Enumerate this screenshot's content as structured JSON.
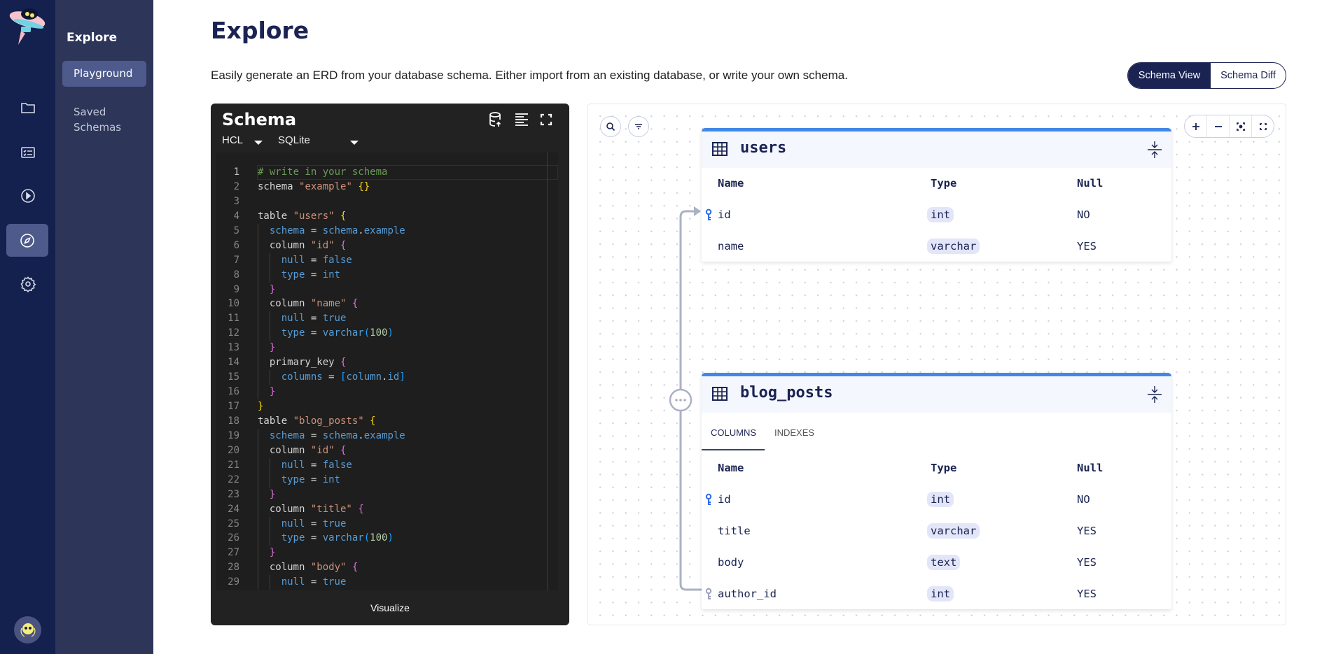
{
  "sidebar": {
    "section_title": "Explore",
    "items": [
      {
        "label": "Playground",
        "active": true
      },
      {
        "label": "Saved Schemas",
        "active": false
      }
    ],
    "rail_icons": [
      "folder-icon",
      "checklist-icon",
      "play-circle-icon",
      "compass-icon",
      "gear-icon"
    ],
    "active_rail": "compass-icon"
  },
  "header": {
    "title": "Explore",
    "description": "Easily generate an ERD from your database schema. Either import from an existing database, or write your own schema.",
    "view_toggle": [
      {
        "label": "Schema View",
        "active": true
      },
      {
        "label": "Schema Diff",
        "active": false
      }
    ]
  },
  "editor": {
    "title": "Schema",
    "language": "HCL",
    "dialect": "SQLite",
    "visualize_label": "Visualize",
    "lines": [
      [
        [
          "# write in your schema",
          "c"
        ]
      ],
      [
        [
          "schema ",
          "p"
        ],
        [
          "\"example\"",
          "s"
        ],
        [
          " ",
          "p"
        ],
        [
          "{}",
          "b1"
        ]
      ],
      [],
      [
        [
          "table ",
          "p"
        ],
        [
          "\"users\"",
          "s"
        ],
        [
          " ",
          "p"
        ],
        [
          "{",
          "b1"
        ]
      ],
      [
        [
          "  ",
          "i"
        ],
        [
          "schema",
          "a"
        ],
        [
          " = ",
          "p"
        ],
        [
          "schema",
          "a"
        ],
        [
          ".",
          "p"
        ],
        [
          "example",
          "a"
        ]
      ],
      [
        [
          "  ",
          "i"
        ],
        [
          "column ",
          "p"
        ],
        [
          "\"id\"",
          "s"
        ],
        [
          " ",
          "p"
        ],
        [
          "{",
          "b2"
        ]
      ],
      [
        [
          "    ",
          "i"
        ],
        [
          "null",
          "a"
        ],
        [
          " = ",
          "p"
        ],
        [
          "false",
          "a"
        ]
      ],
      [
        [
          "    ",
          "i"
        ],
        [
          "type",
          "a"
        ],
        [
          " = ",
          "p"
        ],
        [
          "int",
          "a"
        ]
      ],
      [
        [
          "  ",
          "i"
        ],
        [
          "}",
          "b2"
        ]
      ],
      [
        [
          "  ",
          "i"
        ],
        [
          "column ",
          "p"
        ],
        [
          "\"name\"",
          "s"
        ],
        [
          " ",
          "p"
        ],
        [
          "{",
          "b2"
        ]
      ],
      [
        [
          "    ",
          "i"
        ],
        [
          "null",
          "a"
        ],
        [
          " = ",
          "p"
        ],
        [
          "true",
          "a"
        ]
      ],
      [
        [
          "    ",
          "i"
        ],
        [
          "type",
          "a"
        ],
        [
          " = ",
          "p"
        ],
        [
          "varchar",
          "a"
        ],
        [
          "(",
          "b3"
        ],
        [
          "100",
          "n"
        ],
        [
          ")",
          "b3"
        ]
      ],
      [
        [
          "  ",
          "i"
        ],
        [
          "}",
          "b2"
        ]
      ],
      [
        [
          "  ",
          "i"
        ],
        [
          "primary_key ",
          "p"
        ],
        [
          "{",
          "b2"
        ]
      ],
      [
        [
          "    ",
          "i"
        ],
        [
          "columns",
          "a"
        ],
        [
          " = ",
          "p"
        ],
        [
          "[",
          "b3"
        ],
        [
          "column",
          "a"
        ],
        [
          ".",
          "p"
        ],
        [
          "id",
          "a"
        ],
        [
          "]",
          "b3"
        ]
      ],
      [
        [
          "  ",
          "i"
        ],
        [
          "}",
          "b2"
        ]
      ],
      [
        [
          "}",
          "b1"
        ]
      ],
      [
        [
          "table ",
          "p"
        ],
        [
          "\"blog_posts\"",
          "s"
        ],
        [
          " ",
          "p"
        ],
        [
          "{",
          "b1"
        ]
      ],
      [
        [
          "  ",
          "i"
        ],
        [
          "schema",
          "a"
        ],
        [
          " = ",
          "p"
        ],
        [
          "schema",
          "a"
        ],
        [
          ".",
          "p"
        ],
        [
          "example",
          "a"
        ]
      ],
      [
        [
          "  ",
          "i"
        ],
        [
          "column ",
          "p"
        ],
        [
          "\"id\"",
          "s"
        ],
        [
          " ",
          "p"
        ],
        [
          "{",
          "b2"
        ]
      ],
      [
        [
          "    ",
          "i"
        ],
        [
          "null",
          "a"
        ],
        [
          " = ",
          "p"
        ],
        [
          "false",
          "a"
        ]
      ],
      [
        [
          "    ",
          "i"
        ],
        [
          "type",
          "a"
        ],
        [
          " = ",
          "p"
        ],
        [
          "int",
          "a"
        ]
      ],
      [
        [
          "  ",
          "i"
        ],
        [
          "}",
          "b2"
        ]
      ],
      [
        [
          "  ",
          "i"
        ],
        [
          "column ",
          "p"
        ],
        [
          "\"title\"",
          "s"
        ],
        [
          " ",
          "p"
        ],
        [
          "{",
          "b2"
        ]
      ],
      [
        [
          "    ",
          "i"
        ],
        [
          "null",
          "a"
        ],
        [
          " = ",
          "p"
        ],
        [
          "true",
          "a"
        ]
      ],
      [
        [
          "    ",
          "i"
        ],
        [
          "type",
          "a"
        ],
        [
          " = ",
          "p"
        ],
        [
          "varchar",
          "a"
        ],
        [
          "(",
          "b3"
        ],
        [
          "100",
          "n"
        ],
        [
          ")",
          "b3"
        ]
      ],
      [
        [
          "  ",
          "i"
        ],
        [
          "}",
          "b2"
        ]
      ],
      [
        [
          "  ",
          "i"
        ],
        [
          "column ",
          "p"
        ],
        [
          "\"body\"",
          "s"
        ],
        [
          " ",
          "p"
        ],
        [
          "{",
          "b2"
        ]
      ],
      [
        [
          "    ",
          "i"
        ],
        [
          "null",
          "a"
        ],
        [
          " = ",
          "p"
        ],
        [
          "true",
          "a"
        ]
      ]
    ]
  },
  "erd": {
    "accent_color": "#4088e8",
    "columns_header": [
      "Name",
      "Type",
      "Null"
    ],
    "tables": [
      {
        "name": "users",
        "rows": [
          {
            "name": "id",
            "type": "int",
            "null": "NO",
            "key": "primary"
          },
          {
            "name": "name",
            "type": "varchar",
            "null": "YES",
            "key": ""
          }
        ]
      },
      {
        "name": "blog_posts",
        "tabs": [
          "COLUMNS",
          "INDEXES"
        ],
        "active_tab": "COLUMNS",
        "rows": [
          {
            "name": "id",
            "type": "int",
            "null": "NO",
            "key": "primary"
          },
          {
            "name": "title",
            "type": "varchar",
            "null": "YES",
            "key": ""
          },
          {
            "name": "body",
            "type": "text",
            "null": "YES",
            "key": ""
          },
          {
            "name": "author_id",
            "type": "int",
            "null": "YES",
            "key": "foreign"
          }
        ]
      }
    ]
  }
}
